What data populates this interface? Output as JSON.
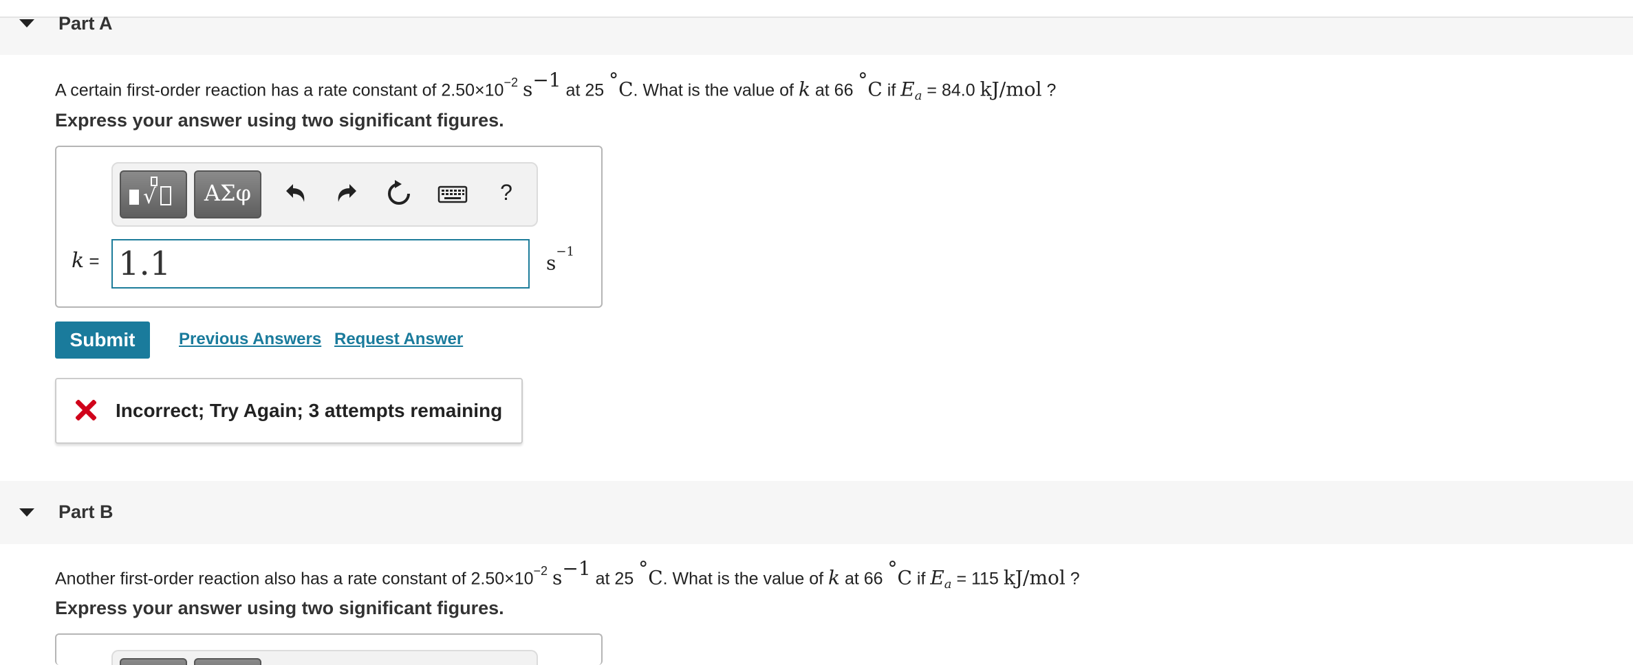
{
  "partA": {
    "title": "Part A",
    "question": {
      "t1": "A certain first-order reaction has a rate constant of 2.50×10",
      "exp1": "−2",
      "unit_s": "s",
      "unit_exp": "−1",
      "t2": " at 25 ",
      "deg": "°C",
      "t3": ". What is the value of ",
      "k": "k",
      "t4": " at 66 ",
      "t5": " if ",
      "E": "E",
      "a": "a",
      "t6": " = 84.0 ",
      "kjmol": "kJ/mol",
      "t7": " ?"
    },
    "instruction": "Express your answer using two significant figures.",
    "toolbar": {
      "templates_label": "▮√▯",
      "greek_label": "ΑΣφ",
      "undo_icon": "undo-icon",
      "redo_icon": "redo-icon",
      "reset_icon": "reset-icon",
      "keyboard_icon": "keyboard-icon",
      "help_label": "?"
    },
    "input": {
      "variable": "k",
      "equals": " =",
      "value": "1.1",
      "unit": "s",
      "unit_exp": "−1"
    },
    "submit_label": "Submit",
    "previous_answers_label": "Previous Answers",
    "request_answer_label": "Request Answer",
    "feedback": {
      "icon": "close-icon",
      "text": "Incorrect; Try Again; 3 attempts remaining",
      "color": "#d0021b"
    }
  },
  "partB": {
    "title": "Part B",
    "question": {
      "t1": "Another first-order reaction also has a rate constant of 2.50×10",
      "exp1": "−2",
      "unit_s": "s",
      "unit_exp": "−1",
      "t2": " at 25 ",
      "deg": "°C",
      "t3": ". What is the value of ",
      "k": "k",
      "t4": " at 66 ",
      "t5": " if ",
      "E": "E",
      "a": "a",
      "t6": " = 115 ",
      "kjmol": "kJ/mol",
      "t7": " ?"
    },
    "instruction": "Express your answer using two significant figures."
  },
  "colors": {
    "accent": "#1a7b9c",
    "input_border": "#1c7c9a",
    "error": "#d0021b",
    "header_bg": "#f6f6f6"
  }
}
